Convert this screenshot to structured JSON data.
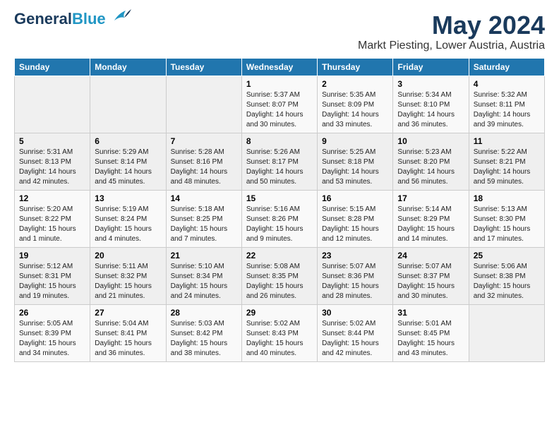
{
  "header": {
    "logo_line1": "General",
    "logo_line2": "Blue",
    "month_year": "May 2024",
    "location": "Markt Piesting, Lower Austria, Austria"
  },
  "days_of_week": [
    "Sunday",
    "Monday",
    "Tuesday",
    "Wednesday",
    "Thursday",
    "Friday",
    "Saturday"
  ],
  "weeks": [
    [
      {
        "day": "",
        "info": ""
      },
      {
        "day": "",
        "info": ""
      },
      {
        "day": "",
        "info": ""
      },
      {
        "day": "1",
        "info": "Sunrise: 5:37 AM\nSunset: 8:07 PM\nDaylight: 14 hours\nand 30 minutes."
      },
      {
        "day": "2",
        "info": "Sunrise: 5:35 AM\nSunset: 8:09 PM\nDaylight: 14 hours\nand 33 minutes."
      },
      {
        "day": "3",
        "info": "Sunrise: 5:34 AM\nSunset: 8:10 PM\nDaylight: 14 hours\nand 36 minutes."
      },
      {
        "day": "4",
        "info": "Sunrise: 5:32 AM\nSunset: 8:11 PM\nDaylight: 14 hours\nand 39 minutes."
      }
    ],
    [
      {
        "day": "5",
        "info": "Sunrise: 5:31 AM\nSunset: 8:13 PM\nDaylight: 14 hours\nand 42 minutes."
      },
      {
        "day": "6",
        "info": "Sunrise: 5:29 AM\nSunset: 8:14 PM\nDaylight: 14 hours\nand 45 minutes."
      },
      {
        "day": "7",
        "info": "Sunrise: 5:28 AM\nSunset: 8:16 PM\nDaylight: 14 hours\nand 48 minutes."
      },
      {
        "day": "8",
        "info": "Sunrise: 5:26 AM\nSunset: 8:17 PM\nDaylight: 14 hours\nand 50 minutes."
      },
      {
        "day": "9",
        "info": "Sunrise: 5:25 AM\nSunset: 8:18 PM\nDaylight: 14 hours\nand 53 minutes."
      },
      {
        "day": "10",
        "info": "Sunrise: 5:23 AM\nSunset: 8:20 PM\nDaylight: 14 hours\nand 56 minutes."
      },
      {
        "day": "11",
        "info": "Sunrise: 5:22 AM\nSunset: 8:21 PM\nDaylight: 14 hours\nand 59 minutes."
      }
    ],
    [
      {
        "day": "12",
        "info": "Sunrise: 5:20 AM\nSunset: 8:22 PM\nDaylight: 15 hours\nand 1 minute."
      },
      {
        "day": "13",
        "info": "Sunrise: 5:19 AM\nSunset: 8:24 PM\nDaylight: 15 hours\nand 4 minutes."
      },
      {
        "day": "14",
        "info": "Sunrise: 5:18 AM\nSunset: 8:25 PM\nDaylight: 15 hours\nand 7 minutes."
      },
      {
        "day": "15",
        "info": "Sunrise: 5:16 AM\nSunset: 8:26 PM\nDaylight: 15 hours\nand 9 minutes."
      },
      {
        "day": "16",
        "info": "Sunrise: 5:15 AM\nSunset: 8:28 PM\nDaylight: 15 hours\nand 12 minutes."
      },
      {
        "day": "17",
        "info": "Sunrise: 5:14 AM\nSunset: 8:29 PM\nDaylight: 15 hours\nand 14 minutes."
      },
      {
        "day": "18",
        "info": "Sunrise: 5:13 AM\nSunset: 8:30 PM\nDaylight: 15 hours\nand 17 minutes."
      }
    ],
    [
      {
        "day": "19",
        "info": "Sunrise: 5:12 AM\nSunset: 8:31 PM\nDaylight: 15 hours\nand 19 minutes."
      },
      {
        "day": "20",
        "info": "Sunrise: 5:11 AM\nSunset: 8:32 PM\nDaylight: 15 hours\nand 21 minutes."
      },
      {
        "day": "21",
        "info": "Sunrise: 5:10 AM\nSunset: 8:34 PM\nDaylight: 15 hours\nand 24 minutes."
      },
      {
        "day": "22",
        "info": "Sunrise: 5:08 AM\nSunset: 8:35 PM\nDaylight: 15 hours\nand 26 minutes."
      },
      {
        "day": "23",
        "info": "Sunrise: 5:07 AM\nSunset: 8:36 PM\nDaylight: 15 hours\nand 28 minutes."
      },
      {
        "day": "24",
        "info": "Sunrise: 5:07 AM\nSunset: 8:37 PM\nDaylight: 15 hours\nand 30 minutes."
      },
      {
        "day": "25",
        "info": "Sunrise: 5:06 AM\nSunset: 8:38 PM\nDaylight: 15 hours\nand 32 minutes."
      }
    ],
    [
      {
        "day": "26",
        "info": "Sunrise: 5:05 AM\nSunset: 8:39 PM\nDaylight: 15 hours\nand 34 minutes."
      },
      {
        "day": "27",
        "info": "Sunrise: 5:04 AM\nSunset: 8:41 PM\nDaylight: 15 hours\nand 36 minutes."
      },
      {
        "day": "28",
        "info": "Sunrise: 5:03 AM\nSunset: 8:42 PM\nDaylight: 15 hours\nand 38 minutes."
      },
      {
        "day": "29",
        "info": "Sunrise: 5:02 AM\nSunset: 8:43 PM\nDaylight: 15 hours\nand 40 minutes."
      },
      {
        "day": "30",
        "info": "Sunrise: 5:02 AM\nSunset: 8:44 PM\nDaylight: 15 hours\nand 42 minutes."
      },
      {
        "day": "31",
        "info": "Sunrise: 5:01 AM\nSunset: 8:45 PM\nDaylight: 15 hours\nand 43 minutes."
      },
      {
        "day": "",
        "info": ""
      }
    ]
  ]
}
